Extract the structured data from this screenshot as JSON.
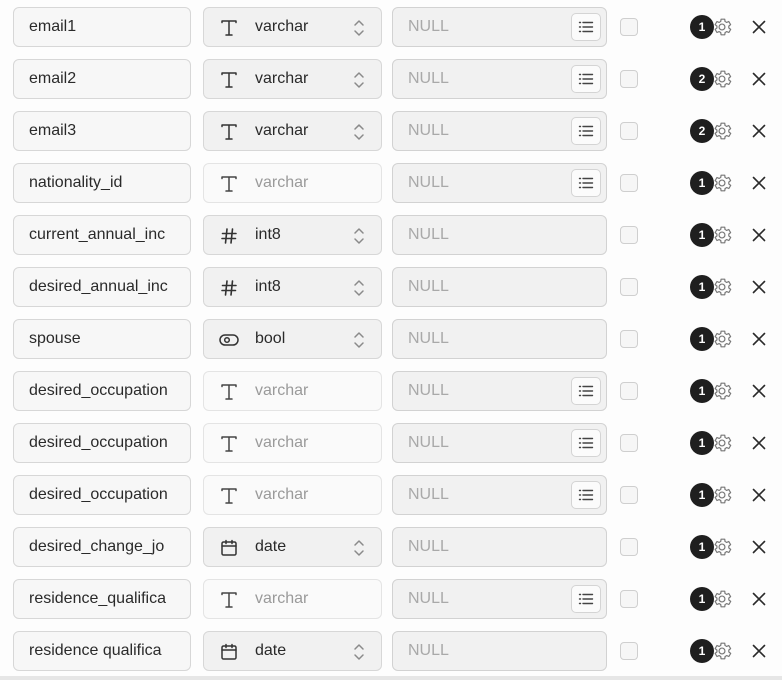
{
  "columns": [
    {
      "name": "email1",
      "type": "varchar",
      "type_icon": "text-type-icon",
      "editable": true,
      "default_placeholder": "NULL",
      "has_list_button": true,
      "badge": "1"
    },
    {
      "name": "email2",
      "type": "varchar",
      "type_icon": "text-type-icon",
      "editable": true,
      "default_placeholder": "NULL",
      "has_list_button": true,
      "badge": "2"
    },
    {
      "name": "email3",
      "type": "varchar",
      "type_icon": "text-type-icon",
      "editable": true,
      "default_placeholder": "NULL",
      "has_list_button": true,
      "badge": "2"
    },
    {
      "name": "nationality_id",
      "type": "varchar",
      "type_icon": "text-type-icon",
      "editable": false,
      "default_placeholder": "NULL",
      "has_list_button": true,
      "badge": "1"
    },
    {
      "name": "current_annual_inc",
      "type": "int8",
      "type_icon": "hash-type-icon",
      "editable": true,
      "default_placeholder": "NULL",
      "has_list_button": false,
      "badge": "1"
    },
    {
      "name": "desired_annual_inc",
      "type": "int8",
      "type_icon": "hash-type-icon",
      "editable": true,
      "default_placeholder": "NULL",
      "has_list_button": false,
      "badge": "1"
    },
    {
      "name": "spouse",
      "type": "bool",
      "type_icon": "toggle-type-icon",
      "editable": true,
      "default_placeholder": "NULL",
      "has_list_button": false,
      "badge": "1"
    },
    {
      "name": "desired_occupation",
      "type": "varchar",
      "type_icon": "text-type-icon",
      "editable": false,
      "default_placeholder": "NULL",
      "has_list_button": true,
      "badge": "1"
    },
    {
      "name": "desired_occupation",
      "type": "varchar",
      "type_icon": "text-type-icon",
      "editable": false,
      "default_placeholder": "NULL",
      "has_list_button": true,
      "badge": "1"
    },
    {
      "name": "desired_occupation",
      "type": "varchar",
      "type_icon": "text-type-icon",
      "editable": false,
      "default_placeholder": "NULL",
      "has_list_button": true,
      "badge": "1"
    },
    {
      "name": "desired_change_jo",
      "type": "date",
      "type_icon": "calendar-type-icon",
      "editable": true,
      "default_placeholder": "NULL",
      "has_list_button": false,
      "badge": "1"
    },
    {
      "name": "residence_qualifica",
      "type": "varchar",
      "type_icon": "text-type-icon",
      "editable": false,
      "default_placeholder": "NULL",
      "has_list_button": true,
      "badge": "1"
    },
    {
      "name": "residence qualifica",
      "type": "date",
      "type_icon": "calendar-type-icon",
      "editable": true,
      "default_placeholder": "NULL",
      "has_list_button": false,
      "badge": "1"
    }
  ]
}
